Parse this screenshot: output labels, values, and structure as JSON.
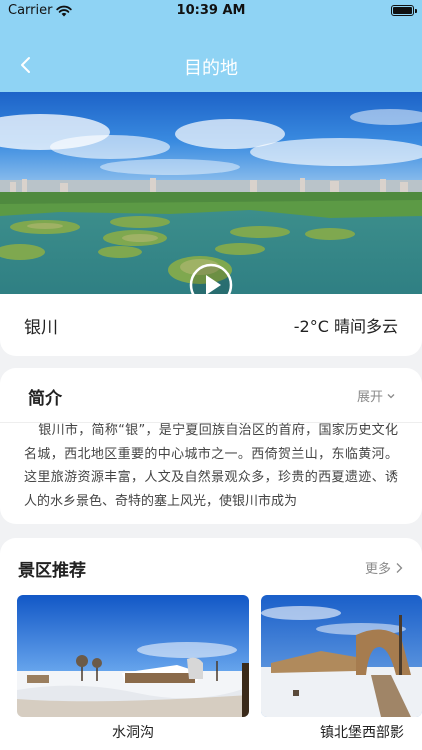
{
  "status_bar": {
    "carrier": "Carrier",
    "time": "10:39 AM",
    "battery_level": 1.0
  },
  "nav": {
    "title": "目的地",
    "back_icon": "chevron-left-icon"
  },
  "hero": {
    "play_icon": "play-icon"
  },
  "city": {
    "name": "银川",
    "weather": "-2°C 晴间多云"
  },
  "intro": {
    "title": "简介",
    "expand_label": "展开",
    "text": "银川市，简称“银”，是宁夏回族自治区的首府，国家历史文化名城，西北地区重要的中心城市之一。西倚贺兰山，东临黄河。这里旅游资源丰富，人文及自然景观众多，珍贵的西夏遗迹、诱人的水乡景色、奇特的塞上风光，使银川市成为"
  },
  "spots": {
    "title": "景区推荐",
    "more_label": "更多",
    "items": [
      {
        "name": "水洞沟"
      },
      {
        "name": "镇北堡西部影"
      }
    ]
  },
  "colors": {
    "header": "#8fd3f4",
    "background": "#f1f2f4",
    "card": "#ffffff",
    "muted_text": "#8a8a8a"
  }
}
